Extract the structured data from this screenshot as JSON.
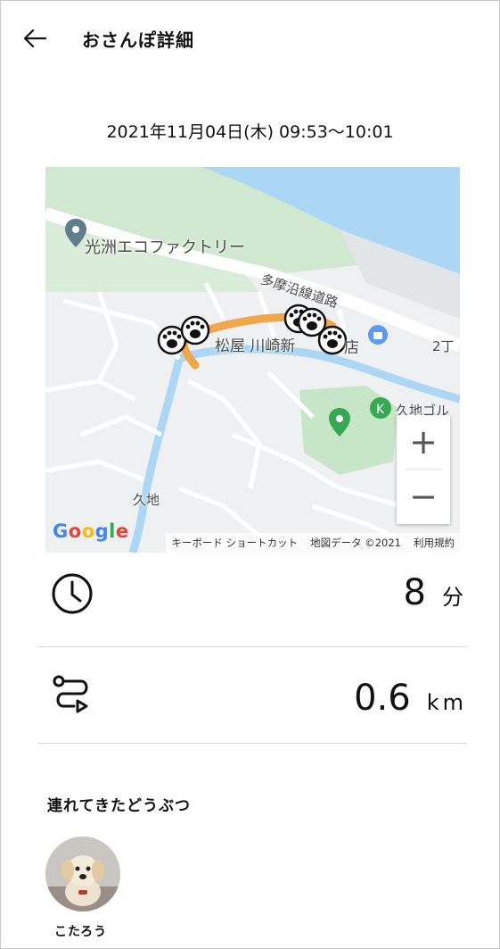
{
  "header": {
    "title": "おさんぽ詳細",
    "back_icon": "arrow-left-icon"
  },
  "walk": {
    "datetime": "2021年11月04日(木) 09:53〜10:01"
  },
  "map": {
    "labels": {
      "poi_factory": "光洲エコファクトリー",
      "road": "多摩沿線道路",
      "store": "松屋 川崎新",
      "store_suffix": "店",
      "district": "久地",
      "block": "2丁",
      "station": "久地ゴル"
    },
    "zoom_in": "+",
    "zoom_out": "−",
    "logo": "Google",
    "attribution": {
      "shortcuts": "キーボード ショートカット",
      "data": "地図データ ©2021",
      "terms": "利用規約"
    },
    "colors": {
      "river": "#abd7f5",
      "park": "#c7e6c7",
      "route": "#f0a64a"
    }
  },
  "stats": {
    "duration": {
      "icon": "clock-icon",
      "value": "8",
      "unit": "分"
    },
    "distance": {
      "icon": "route-icon",
      "value": "0.6",
      "unit": "km"
    }
  },
  "pets": {
    "section_title": "連れてきたどうぶつ",
    "items": [
      {
        "name": "こたろう"
      }
    ]
  }
}
